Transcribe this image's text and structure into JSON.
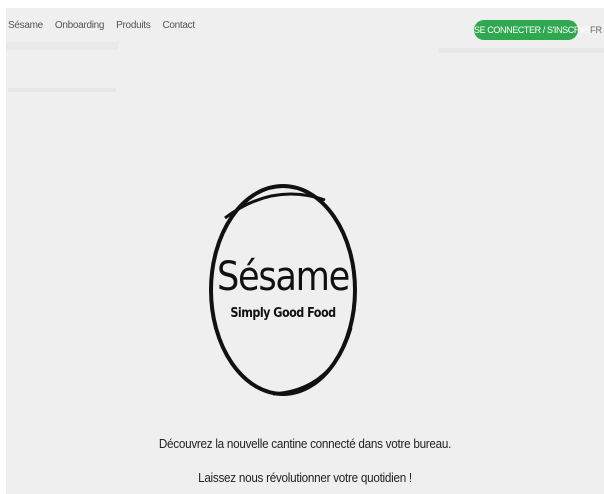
{
  "nav": {
    "links": [
      "Sésame",
      "Onboarding",
      "Produits",
      "Contact"
    ],
    "cta_label": "SE CONNECTER / S'INSCRIRE",
    "lang": "FR ⌄"
  },
  "logo": {
    "title": "Sésame",
    "subtitle": "Simply Good Food"
  },
  "hero": {
    "line1": "Découvrez la nouvelle cantine connecté dans votre bureau.",
    "line2": "Laissez nous révolutionner votre quotidien !"
  },
  "colors": {
    "cta": "#2fa84f",
    "background": "#efefef"
  }
}
